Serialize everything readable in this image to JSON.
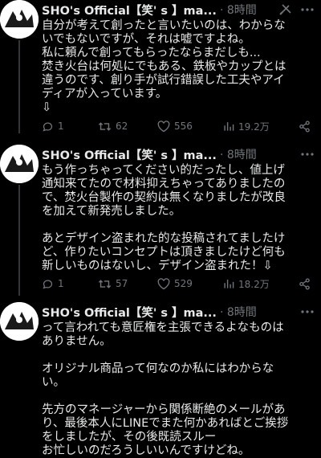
{
  "colors": {
    "background": "#000000",
    "text": "#e7e9ea",
    "muted": "#71767b",
    "divider": "#2f3336"
  },
  "tweets": [
    {
      "name": "SHO's Official【笑' s 】ma...",
      "time": "· 8時間",
      "body": "自分が考えて創ったと言いたいのは、わからな\nいでもないですが、それは嘘ですよね。\n私に頼んで創ってもらったならまだしも...\n焚き火台は何処にでもある、鉄板やカップとは\n違うのです、創り手が試行錯誤した工夫やアイ\nディアが入っています。\n⇩",
      "replies": "1",
      "retweets": "62",
      "likes": "556",
      "views": "19.2万",
      "extra_icon": "bell-icon"
    },
    {
      "name": "SHO's Official【笑' s 】ma...",
      "time": "· 8時間",
      "body": "もう作っちゃってください的だったし、値上げ\n通知来てたので材料抑えちゃってありましたの\nで、焚火台製作の契約は無くなりましたが改良\nを加えて新発売しました。\n\nあとデザイン盗まれた的な投稿されてましたけ\nど、作りたいコンセプトは頂きましたけど何も\n新しいものはないし、デザイン盗まれた！⇩",
      "replies": "1",
      "retweets": "57",
      "likes": "529",
      "views": "18.2万"
    },
    {
      "name": "SHO's Official【笑' s 】ma...",
      "time": "· 8時間",
      "body": "って言われても意匠権を主張できるよなものは\nありません。\n\nオリジナル商品って何なのか私にはわからな\nい。\n\n先方のマネージャーから関係断絶のメールがあ\nり、最後本人にLINEでまた何かあればとご挨拶\nをしましたが、その後既読スルー\nお忙しいのだろうしいいんですけどね。"
    }
  ]
}
